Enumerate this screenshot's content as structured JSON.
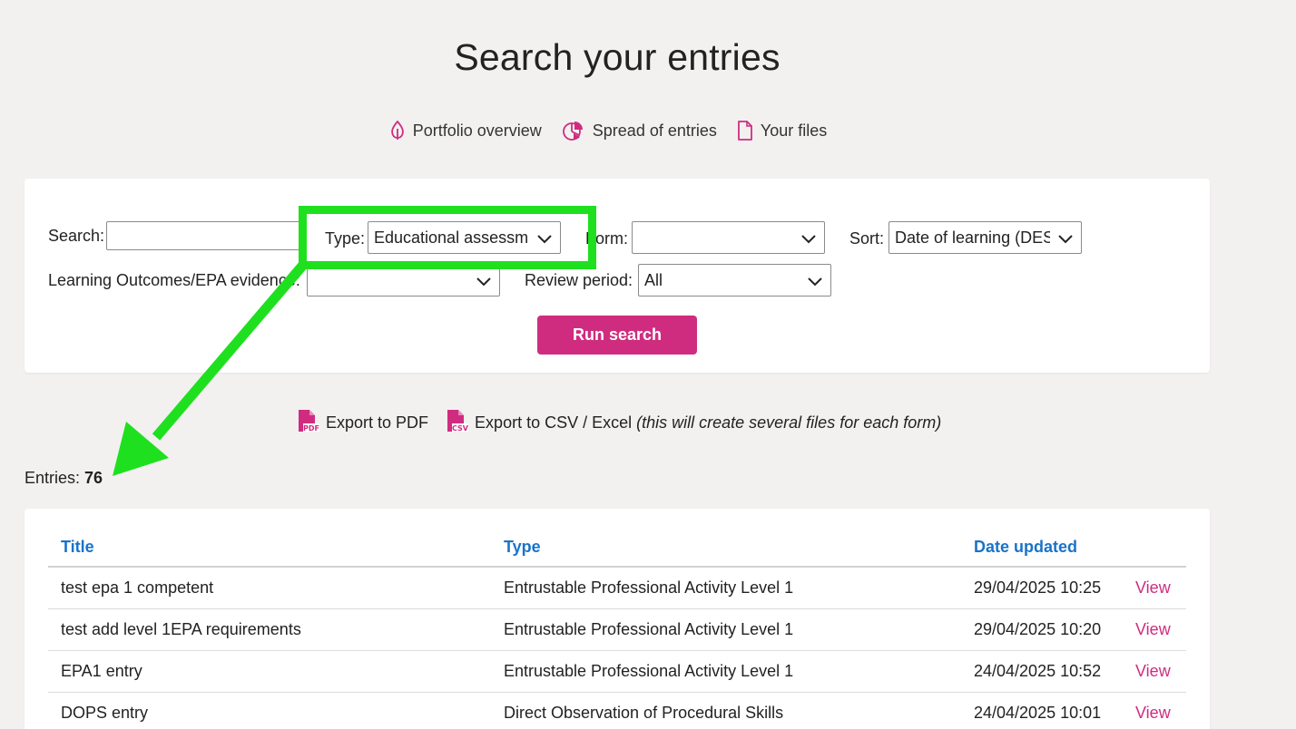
{
  "page": {
    "title": "Search your entries"
  },
  "nav": [
    {
      "label": "Portfolio overview",
      "icon": "leaf-icon"
    },
    {
      "label": "Spread of entries",
      "icon": "pie-chart-icon"
    },
    {
      "label": "Your files",
      "icon": "file-icon"
    }
  ],
  "filters": {
    "search_label": "Search:",
    "search_value": "",
    "type_label": "Type:",
    "type_value": "Educational assessme",
    "form_label": "Form:",
    "form_value": "",
    "sort_label": "Sort:",
    "sort_value": "Date of learning (DES",
    "lo_label": "Learning Outcomes/EPA evidence:",
    "lo_value": "",
    "review_label": "Review period:",
    "review_value": "All",
    "run_button": "Run search"
  },
  "exports": {
    "pdf_label": "Export to PDF",
    "pdf_badge": "PDF",
    "csv_label": "Export to CSV / Excel",
    "csv_badge": "CSV",
    "csv_note": "(this will create several files for each form)"
  },
  "entries": {
    "label": "Entries:",
    "count": "76"
  },
  "table": {
    "headers": {
      "title": "Title",
      "type": "Type",
      "date": "Date updated"
    },
    "rows": [
      {
        "title": "test epa 1 competent",
        "type": "Entrustable Professional Activity Level 1",
        "date": "29/04/2025 10:25",
        "action": "View"
      },
      {
        "title": "test add level 1EPA requirements",
        "type": "Entrustable Professional Activity Level 1",
        "date": "29/04/2025 10:20",
        "action": "View"
      },
      {
        "title": "EPA1 entry",
        "type": "Entrustable Professional Activity Level 1",
        "date": "24/04/2025 10:52",
        "action": "View"
      },
      {
        "title": "DOPS entry",
        "type": "Direct Observation of Procedural Skills",
        "date": "24/04/2025 10:01",
        "action": "View"
      }
    ]
  },
  "colors": {
    "accent": "#cf2c80",
    "link_blue": "#1a73c9",
    "highlight_green": "#1fe01f",
    "background": "#f2f1f0"
  }
}
